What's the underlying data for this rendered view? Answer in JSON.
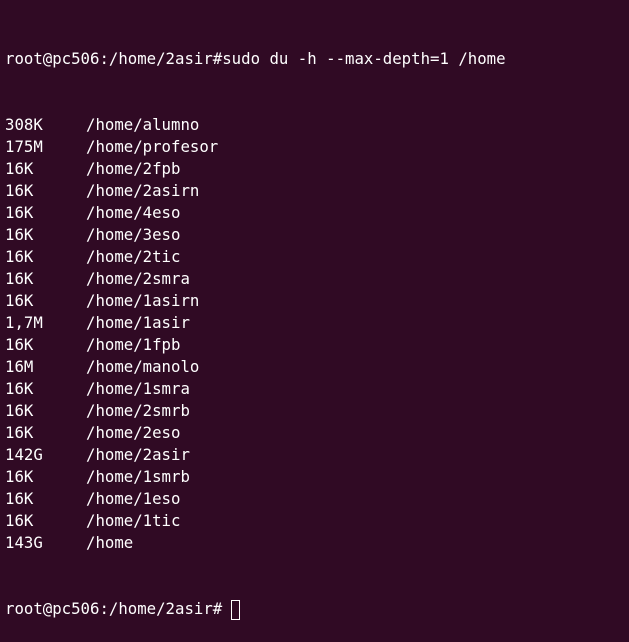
{
  "prompt": "root@pc506:/home/2asir#",
  "command": "sudo du -h --max-depth=1 /home",
  "output": [
    {
      "size": "308K",
      "path": "/home/alumno"
    },
    {
      "size": "175M",
      "path": "/home/profesor"
    },
    {
      "size": "16K",
      "path": "/home/2fpb"
    },
    {
      "size": "16K",
      "path": "/home/2asirn"
    },
    {
      "size": "16K",
      "path": "/home/4eso"
    },
    {
      "size": "16K",
      "path": "/home/3eso"
    },
    {
      "size": "16K",
      "path": "/home/2tic"
    },
    {
      "size": "16K",
      "path": "/home/2smra"
    },
    {
      "size": "16K",
      "path": "/home/1asirn"
    },
    {
      "size": "1,7M",
      "path": "/home/1asir"
    },
    {
      "size": "16K",
      "path": "/home/1fpb"
    },
    {
      "size": "16M",
      "path": "/home/manolo"
    },
    {
      "size": "16K",
      "path": "/home/1smra"
    },
    {
      "size": "16K",
      "path": "/home/2smrb"
    },
    {
      "size": "16K",
      "path": "/home/2eso"
    },
    {
      "size": "142G",
      "path": "/home/2asir"
    },
    {
      "size": "16K",
      "path": "/home/1smrb"
    },
    {
      "size": "16K",
      "path": "/home/1eso"
    },
    {
      "size": "16K",
      "path": "/home/1tic"
    },
    {
      "size": "143G",
      "path": "/home"
    }
  ],
  "final_prompt": "root@pc506:/home/2asir#",
  "colors": {
    "background": "#300a24",
    "text": "#ffffff"
  }
}
